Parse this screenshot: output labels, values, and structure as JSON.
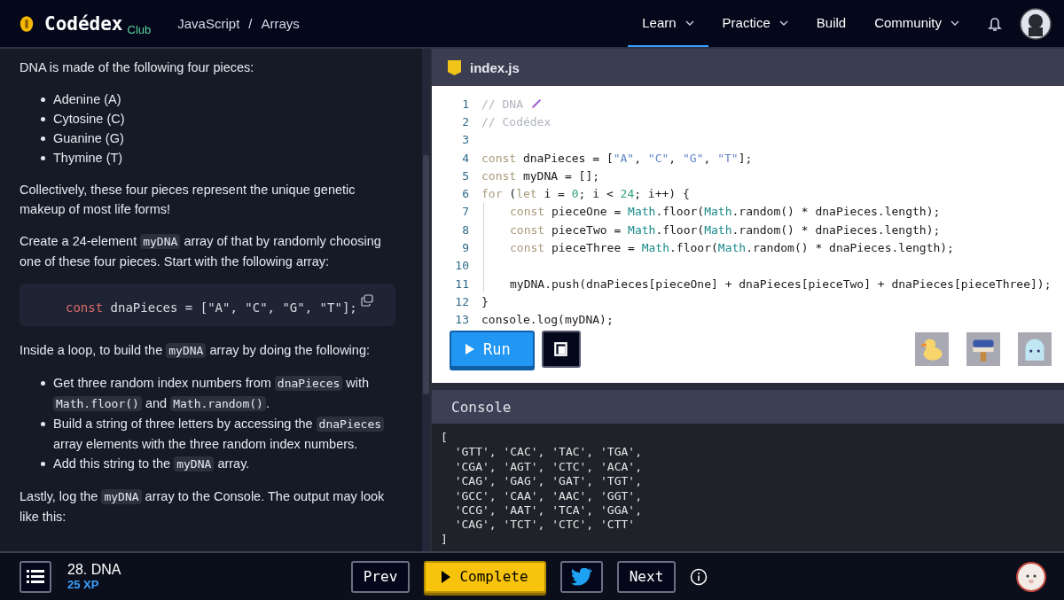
{
  "header": {
    "brand": "Codédex",
    "brand_badge": "Club",
    "breadcrumb": [
      "JavaScript",
      "Arrays"
    ],
    "separator": "/",
    "nav": [
      {
        "label": "Learn",
        "dropdown": true,
        "selected": true
      },
      {
        "label": "Practice",
        "dropdown": true,
        "selected": false
      },
      {
        "label": "Build",
        "dropdown": false,
        "selected": false
      },
      {
        "label": "Community",
        "dropdown": true,
        "selected": false
      }
    ]
  },
  "lesson": {
    "blocks": [
      {
        "kind": "para",
        "parts": [
          {
            "text": "DNA is made of the following four pieces:",
            "kind": "text"
          }
        ]
      },
      {
        "kind": "list",
        "items": [
          [
            {
              "text": "Adenine (A)",
              "kind": "text"
            }
          ],
          [
            {
              "text": "Cytosine (C)",
              "kind": "text"
            }
          ],
          [
            {
              "text": "Guanine (G)",
              "kind": "text"
            }
          ],
          [
            {
              "text": "Thymine (T)",
              "kind": "text"
            }
          ]
        ]
      },
      {
        "kind": "para",
        "parts": [
          {
            "text": "Collectively, these four pieces represent the unique genetic makeup of most life forms!",
            "kind": "text"
          }
        ]
      },
      {
        "kind": "para",
        "parts": [
          {
            "text": "Create a 24-element ",
            "kind": "text"
          },
          {
            "text": "myDNA",
            "kind": "code"
          },
          {
            "text": " array of that by randomly choosing one of these four pieces. Start with the following array:",
            "kind": "text"
          }
        ]
      },
      {
        "kind": "codeblock",
        "tokens": [
          {
            "t": "const",
            "kind": "kw"
          },
          {
            "t": " dnaPieces = [\"A\", \"C\", \"G\", \"T\"];",
            "kind": "plain"
          }
        ]
      },
      {
        "kind": "para",
        "parts": [
          {
            "text": "Inside a loop, to build the ",
            "kind": "text"
          },
          {
            "text": "myDNA",
            "kind": "code"
          },
          {
            "text": " array by doing the following:",
            "kind": "text"
          }
        ]
      },
      {
        "kind": "list",
        "items": [
          [
            {
              "text": "Get three random index numbers from ",
              "kind": "text"
            },
            {
              "text": "dnaPieces",
              "kind": "code"
            },
            {
              "text": " with ",
              "kind": "text"
            },
            {
              "text": "Math.floor()",
              "kind": "code"
            },
            {
              "text": " and ",
              "kind": "text"
            },
            {
              "text": "Math.random()",
              "kind": "code"
            },
            {
              "text": ".",
              "kind": "text"
            }
          ],
          [
            {
              "text": "Build a string of three letters by accessing the ",
              "kind": "text"
            },
            {
              "text": "dnaPieces",
              "kind": "code"
            },
            {
              "text": " array elements with the three random index numbers.",
              "kind": "text"
            }
          ],
          [
            {
              "text": "Add this string to the ",
              "kind": "text"
            },
            {
              "text": "myDNA",
              "kind": "code"
            },
            {
              "text": " array.",
              "kind": "text"
            }
          ]
        ]
      },
      {
        "kind": "para",
        "parts": [
          {
            "text": "Lastly, log the ",
            "kind": "text"
          },
          {
            "text": "myDNA",
            "kind": "code"
          },
          {
            "text": " array to the Console. The output may look like this:",
            "kind": "text"
          }
        ]
      }
    ]
  },
  "editor": {
    "filename": "index.js",
    "lines": [
      {
        "n": "1",
        "indented": false,
        "dna": true,
        "tokens": [
          {
            "t": "// DNA",
            "kind": "com"
          }
        ]
      },
      {
        "n": "2",
        "indented": false,
        "dna": false,
        "tokens": [
          {
            "t": "// Codédex",
            "kind": "com"
          }
        ]
      },
      {
        "n": "3",
        "indented": false,
        "dna": false
      },
      {
        "n": "4",
        "indented": false,
        "dna": false,
        "tokens": [
          {
            "t": "const",
            "kind": "kw"
          },
          {
            "t": " dnaPieces = [",
            "kind": "plain"
          },
          {
            "t": "\"A\"",
            "kind": "str"
          },
          {
            "t": ", ",
            "kind": "plain"
          },
          {
            "t": "\"C\"",
            "kind": "str"
          },
          {
            "t": ", ",
            "kind": "plain"
          },
          {
            "t": "\"G\"",
            "kind": "str"
          },
          {
            "t": ", ",
            "kind": "plain"
          },
          {
            "t": "\"T\"",
            "kind": "str"
          },
          {
            "t": "];",
            "kind": "plain"
          }
        ]
      },
      {
        "n": "5",
        "indented": false,
        "dna": false,
        "tokens": [
          {
            "t": "const",
            "kind": "kw"
          },
          {
            "t": " myDNA = [];",
            "kind": "plain"
          }
        ]
      },
      {
        "n": "6",
        "indented": false,
        "dna": false,
        "tokens": [
          {
            "t": "for",
            "kind": "kw"
          },
          {
            "t": " (",
            "kind": "plain"
          },
          {
            "t": "let",
            "kind": "kw"
          },
          {
            "t": " i = ",
            "kind": "plain"
          },
          {
            "t": "0",
            "kind": "num"
          },
          {
            "t": "; i < ",
            "kind": "plain"
          },
          {
            "t": "24",
            "kind": "num"
          },
          {
            "t": "; i++) {",
            "kind": "plain"
          }
        ]
      },
      {
        "n": "7",
        "indented": true,
        "dna": false,
        "tokens": [
          {
            "t": "const",
            "kind": "kw"
          },
          {
            "t": " pieceOne = ",
            "kind": "plain"
          },
          {
            "t": "Math",
            "kind": "obj"
          },
          {
            "t": ".floor(",
            "kind": "plain"
          },
          {
            "t": "Math",
            "kind": "obj"
          },
          {
            "t": ".random() * dnaPieces.length);",
            "kind": "plain"
          }
        ]
      },
      {
        "n": "8",
        "indented": true,
        "dna": false,
        "tokens": [
          {
            "t": "const",
            "kind": "kw"
          },
          {
            "t": " pieceTwo = ",
            "kind": "plain"
          },
          {
            "t": "Math",
            "kind": "obj"
          },
          {
            "t": ".floor(",
            "kind": "plain"
          },
          {
            "t": "Math",
            "kind": "obj"
          },
          {
            "t": ".random() * dnaPieces.length);",
            "kind": "plain"
          }
        ]
      },
      {
        "n": "9",
        "indented": true,
        "dna": false,
        "tokens": [
          {
            "t": "const",
            "kind": "kw"
          },
          {
            "t": " pieceThree = ",
            "kind": "plain"
          },
          {
            "t": "Math",
            "kind": "obj"
          },
          {
            "t": ".floor(",
            "kind": "plain"
          },
          {
            "t": "Math",
            "kind": "obj"
          },
          {
            "t": ".random() * dnaPieces.length);",
            "kind": "plain"
          }
        ]
      },
      {
        "n": "10",
        "indented": true,
        "dna": false
      },
      {
        "n": "11",
        "indented": true,
        "dna": false,
        "tokens": [
          {
            "t": "myDNA.push(dnaPieces[pieceOne] + dnaPieces[pieceTwo] + dnaPieces[pieceThree]);",
            "kind": "plain"
          }
        ]
      },
      {
        "n": "12",
        "indented": false,
        "dna": false,
        "tokens": [
          {
            "t": "}",
            "kind": "plain"
          }
        ]
      },
      {
        "n": "13",
        "indented": false,
        "dna": false,
        "tokens": [
          {
            "t": "console.log(myDNA);",
            "kind": "plain"
          }
        ]
      }
    ],
    "run_label": "Run"
  },
  "console": {
    "title": "Console",
    "lines": [
      "[",
      "  'GTT', 'CAC', 'TAC', 'TGA',",
      "  'CGA', 'AGT', 'CTC', 'ACA',",
      "  'CAG', 'GAG', 'GAT', 'TGT',",
      "  'GCC', 'CAA', 'AAC', 'GGT',",
      "  'CCG', 'AAT', 'TCA', 'GGA',",
      "  'CAG', 'TCT', 'CTC', 'CTT'",
      "]"
    ]
  },
  "footer": {
    "exercise": "28. DNA",
    "xp": "25 XP",
    "prev": "Prev",
    "complete": "Complete",
    "next": "Next"
  }
}
